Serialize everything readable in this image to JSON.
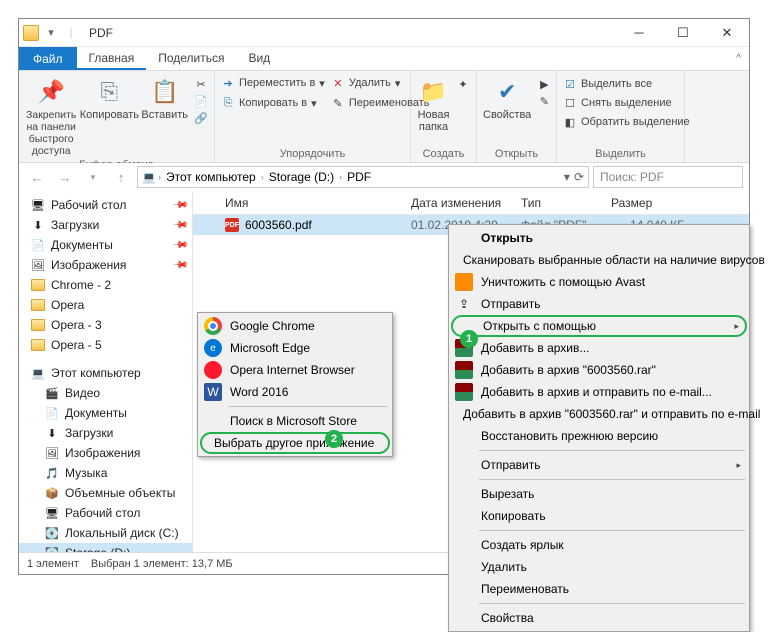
{
  "title": "PDF",
  "tabs": {
    "file": "Файл",
    "home": "Главная",
    "share": "Поделиться",
    "view": "Вид"
  },
  "ribbon": {
    "clipboard": {
      "pin": "Закрепить на панели\nбыстрого доступа",
      "copy": "Копировать",
      "paste": "Вставить",
      "label": "Буфер обмена"
    },
    "organize": {
      "move": "Переместить в",
      "copy": "Копировать в",
      "delete": "Удалить",
      "rename": "Переименовать",
      "label": "Упорядочить"
    },
    "new": {
      "folder": "Новая\nпапка",
      "label": "Создать"
    },
    "open": {
      "props": "Свойства",
      "label": "Открыть"
    },
    "select": {
      "all": "Выделить все",
      "none": "Снять выделение",
      "invert": "Обратить выделение",
      "label": "Выделить"
    }
  },
  "breadcrumb": {
    "pc": "Этот компьютер",
    "drive": "Storage (D:)",
    "folder": "PDF"
  },
  "search": {
    "placeholder": "Поиск: PDF"
  },
  "sidebar": {
    "quick": [
      {
        "label": "Рабочий стол",
        "pin": true,
        "icon": "desktop"
      },
      {
        "label": "Загрузки",
        "pin": true,
        "icon": "downloads"
      },
      {
        "label": "Документы",
        "pin": true,
        "icon": "documents"
      },
      {
        "label": "Изображения",
        "pin": true,
        "icon": "pictures"
      },
      {
        "label": "Chrome - 2",
        "pin": false,
        "icon": "folder"
      },
      {
        "label": "Opera",
        "pin": false,
        "icon": "folder"
      },
      {
        "label": "Opera - 3",
        "pin": false,
        "icon": "folder"
      },
      {
        "label": "Opera - 5",
        "pin": false,
        "icon": "folder"
      }
    ],
    "thispc": "Этот компьютер",
    "pcitems": [
      {
        "label": "Видео",
        "icon": "video"
      },
      {
        "label": "Документы",
        "icon": "documents"
      },
      {
        "label": "Загрузки",
        "icon": "downloads"
      },
      {
        "label": "Изображения",
        "icon": "pictures"
      },
      {
        "label": "Музыка",
        "icon": "music"
      },
      {
        "label": "Объемные объекты",
        "icon": "3d"
      },
      {
        "label": "Рабочий стол",
        "icon": "desktop"
      },
      {
        "label": "Локальный диск (C:)",
        "icon": "drive"
      },
      {
        "label": "Storage (D:)",
        "icon": "drive",
        "selected": true
      }
    ]
  },
  "columns": {
    "name": "Имя",
    "date": "Дата изменения",
    "type": "Тип",
    "size": "Размер"
  },
  "files": [
    {
      "name": "6003560.pdf",
      "date": "01.02.2019 4:29",
      "type": "Файл \"PDF\"",
      "size": "14 040 КБ"
    }
  ],
  "status": {
    "count": "1 элемент",
    "selected": "Выбран 1 элемент: 13,7 МБ"
  },
  "contextMenu": {
    "open": "Открыть",
    "scan": "Сканировать выбранные области на наличие вирусов",
    "shred": "Уничтожить с помощью Avast",
    "share": "Отправить",
    "openwith": "Открыть с помощью",
    "addarchive": "Добавить в архив...",
    "addrar": "Добавить в архив \"6003560.rar\"",
    "addemail": "Добавить в архив и отправить по e-mail...",
    "addraremail": "Добавить в архив \"6003560.rar\" и отправить по e-mail",
    "restore": "Восстановить прежнюю версию",
    "sendto": "Отправить",
    "cut": "Вырезать",
    "copy": "Копировать",
    "shortcut": "Создать ярлык",
    "delete": "Удалить",
    "rename": "Переименовать",
    "props": "Свойства"
  },
  "submenu": {
    "chrome": "Google Chrome",
    "edge": "Microsoft Edge",
    "opera": "Opera Internet Browser",
    "word": "Word 2016",
    "store": "Поиск в Microsoft Store",
    "other": "Выбрать другое приложение"
  },
  "badges": {
    "b1": "1",
    "b2": "2"
  }
}
